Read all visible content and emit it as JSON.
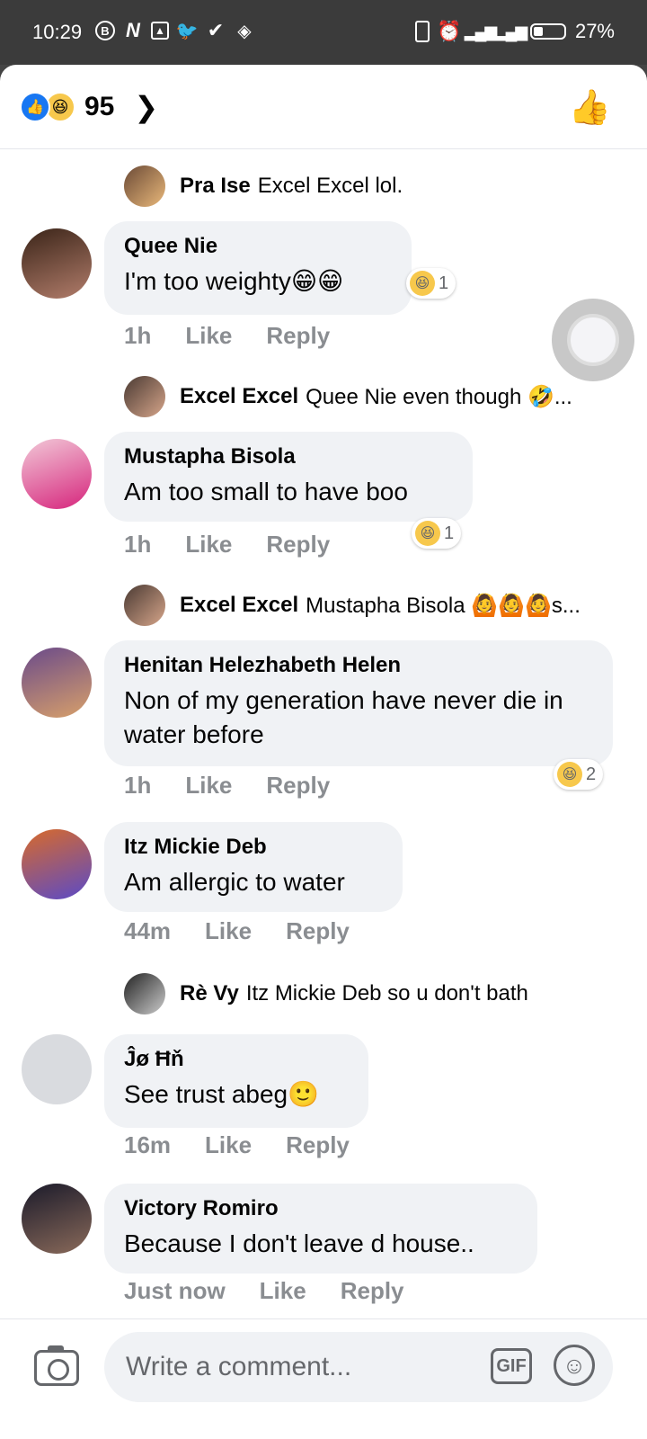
{
  "status_bar": {
    "time": "10:29",
    "battery": "27%",
    "icons": [
      "b-circle-icon",
      "n-icon",
      "image-icon",
      "twitter-icon",
      "check-icon",
      "layers-icon"
    ]
  },
  "header": {
    "reaction_count": "95",
    "reaction_icons": [
      "like-icon",
      "haha-icon"
    ]
  },
  "comments": [
    {
      "type": "reply_preview",
      "name": "Pra Ise",
      "text": "Excel Excel lol."
    },
    {
      "type": "comment",
      "name": "Quee Nie",
      "text": "I'm too weighty😁😁",
      "time": "1h",
      "like": "Like",
      "reply": "Reply",
      "reaction_count": "1"
    },
    {
      "type": "reply_preview",
      "name": "Excel Excel",
      "text": "Quee Nie even though 🤣..."
    },
    {
      "type": "comment",
      "name": "Mustapha Bisola",
      "text": "Am too small to have boo",
      "time": "1h",
      "like": "Like",
      "reply": "Reply",
      "reaction_count": "1"
    },
    {
      "type": "reply_preview",
      "name": "Excel Excel",
      "text": "Mustapha Bisola 🙆🙆🙆s..."
    },
    {
      "type": "comment",
      "name": "Henitan Helezhabeth Helen",
      "text": "Non of my generation have never die in water before",
      "time": "1h",
      "like": "Like",
      "reply": "Reply",
      "reaction_count": "2"
    },
    {
      "type": "comment",
      "name": "Itz Mickie Deb",
      "text": "Am allergic to water",
      "time": "44m",
      "like": "Like",
      "reply": "Reply"
    },
    {
      "type": "reply_preview",
      "name": "Rè Vy",
      "text": "Itz Mickie Deb so u don't bath"
    },
    {
      "type": "comment",
      "name": "Ĵø Ħň",
      "text": "See trust abeg🙂",
      "time": "16m",
      "like": "Like",
      "reply": "Reply"
    },
    {
      "type": "comment",
      "name": "Victory Romiro",
      "text": "Because I don't leave d house..",
      "time": "Just now",
      "like": "Like",
      "reply": "Reply"
    }
  ],
  "composer": {
    "placeholder": "Write a comment...",
    "gif_label": "GIF"
  },
  "colors": {
    "bubble": "#f0f2f5",
    "meta_text": "#8a8d91",
    "like_blue": "#1877f2",
    "haha_yellow": "#f7c84c"
  }
}
